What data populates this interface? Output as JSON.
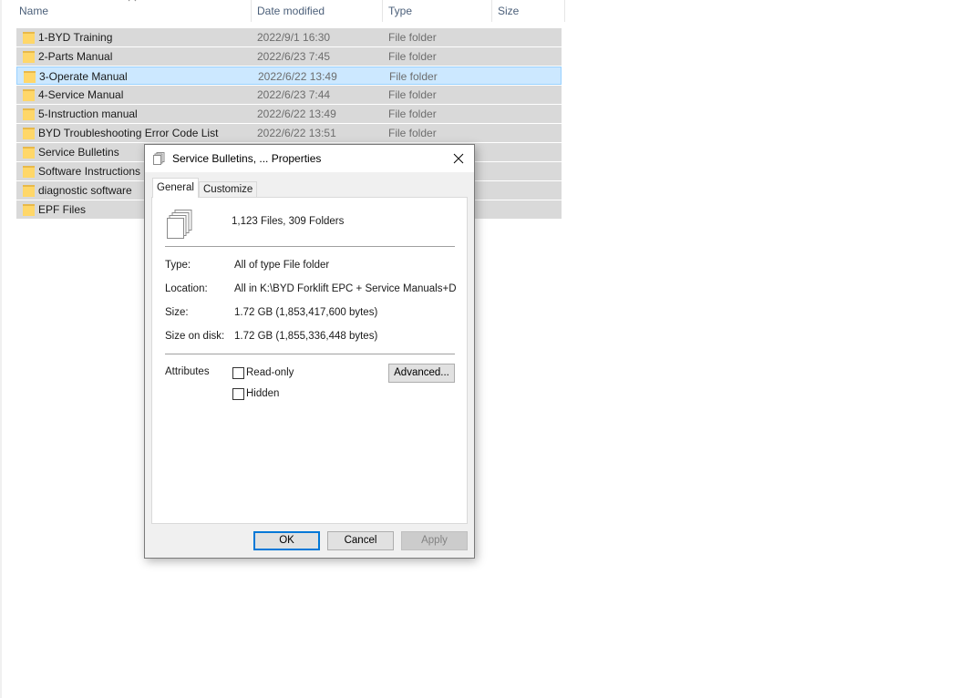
{
  "explorer": {
    "columns": {
      "name": "Name",
      "date_modified": "Date modified",
      "type": "Type",
      "size": "Size"
    },
    "rows": [
      {
        "name": "1-BYD Training",
        "date": "2022/9/1 16:30",
        "type": "File folder",
        "selected": false
      },
      {
        "name": "2-Parts Manual",
        "date": "2022/6/23 7:45",
        "type": "File folder",
        "selected": false
      },
      {
        "name": "3-Operate Manual",
        "date": "2022/6/22 13:49",
        "type": "File folder",
        "selected": true
      },
      {
        "name": "4-Service Manual",
        "date": "2022/6/23 7:44",
        "type": "File folder",
        "selected": false
      },
      {
        "name": "5-Instruction manual",
        "date": "2022/6/22 13:49",
        "type": "File folder",
        "selected": false
      },
      {
        "name": "BYD Troubleshooting Error Code List",
        "date": "2022/6/22 13:51",
        "type": "File folder",
        "selected": false
      },
      {
        "name": "Service Bulletins",
        "date": "",
        "type": "",
        "selected": false
      },
      {
        "name": "Software Instructions",
        "date": "",
        "type": "",
        "selected": false
      },
      {
        "name": "diagnostic software",
        "date": "",
        "type": "",
        "selected": false
      },
      {
        "name": "EPF Files",
        "date": "",
        "type": "",
        "selected": false
      }
    ],
    "folder_color": "#ffd769"
  },
  "dialog": {
    "title": "Service Bulletins, ... Properties",
    "tabs": {
      "general": "General",
      "customize": "Customize"
    },
    "summary": "1,123 Files, 309 Folders",
    "fields": {
      "type_label": "Type:",
      "type_value": "All of type File folder",
      "location_label": "Location:",
      "location_value": "All in K:\\BYD Forklift EPC + Service Manuals+Diagnostic",
      "size_label": "Size:",
      "size_value": "1.72 GB (1,853,417,600 bytes)",
      "size_on_disk_label": "Size on disk:",
      "size_on_disk_value": "1.72 GB (1,855,336,448 bytes)"
    },
    "attributes": {
      "label": "Attributes",
      "read_only": "Read-only",
      "hidden": "Hidden",
      "advanced": "Advanced..."
    },
    "buttons": {
      "ok": "OK",
      "cancel": "Cancel",
      "apply": "Apply"
    },
    "accent_color": "#0078d7"
  }
}
